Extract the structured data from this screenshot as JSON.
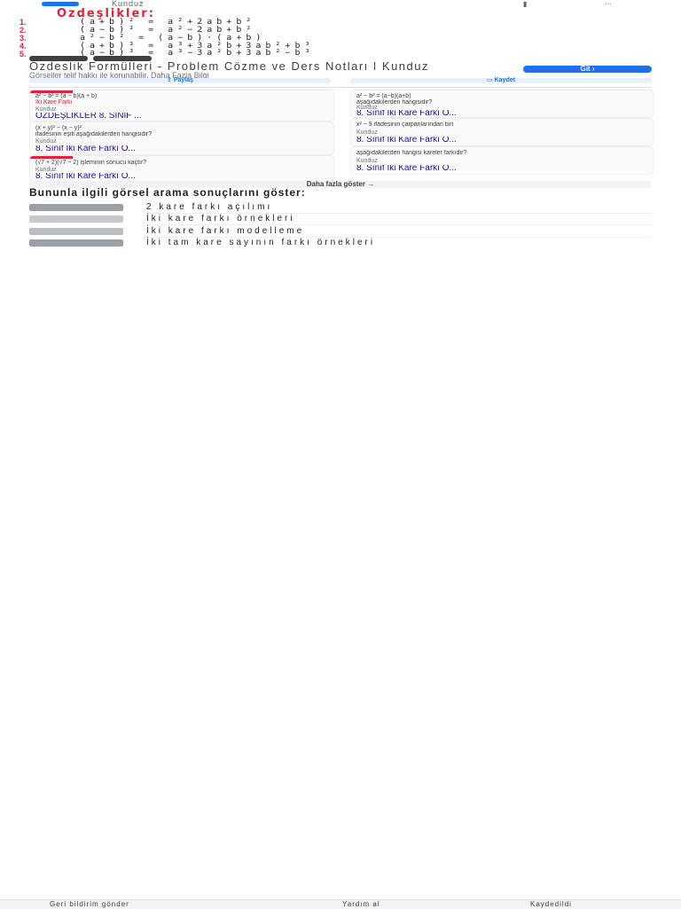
{
  "topbar": {
    "source": "Kunduz",
    "icon_left": "bookmark-icon",
    "icon_right": "more-icon"
  },
  "hero": {
    "title": "Özdeşlikler:",
    "items": [
      {
        "num": "1.",
        "formula": "(a+b)² = a²+2ab+b²"
      },
      {
        "num": "2.",
        "formula": "(a−b)² = a²−2ab+b²"
      },
      {
        "num": "3.",
        "formula": "a²−b² = (a−b)·(a+b)"
      },
      {
        "num": "4.",
        "formula": "(a+b)³ = a³+3a²b+3ab²+b³"
      },
      {
        "num": "5.",
        "formula": "(a−b)³ = a³−3a²b+3ab²−b³"
      }
    ]
  },
  "result": {
    "title": "Özdeşlik Formülleri - Problem Çözme ve Ders Notları | Kunduz",
    "subline": "Görseller telif hakkı ile korunabilir. Daha Fazla Bilgi",
    "visit_label": "Git",
    "share_label": "Paylaş",
    "save_label": "Kaydet"
  },
  "cards_left": [
    {
      "lines": [
        "a² − b² = (a − b)(a + b)",
        "İki Kare Farkı"
      ],
      "source": "Kunduz",
      "title": "ÖZDEŞLİKLER 8. SINIF ..."
    },
    {
      "lines": [
        "(x + y)² − (x − y)²",
        "ifadesinin eşiti aşağıdakilerden hangisidir?"
      ],
      "source": "Kunduz",
      "title": "8. Sınıf İki Kare Farkı Ö..."
    },
    {
      "lines": [
        "(√7 + 2)(√7 − 2) işleminin sonucu kaçtır?"
      ],
      "source": "Kunduz",
      "title": "8. Sınıf İki Kare Farkı Ö..."
    }
  ],
  "cards_right": [
    {
      "lines": [
        "a² − b² = (a−b)(a+b)",
        "aşağıdakilerden hangisidir?"
      ],
      "source": "Kunduz",
      "title": "8. Sınıf İki Kare Farkı Ö..."
    },
    {
      "lines": [
        "x² − 9 ifadesinin çarpanlarından biri"
      ],
      "source": "Kunduz",
      "title": "8. Sınıf İki Kare Farkı Ö..."
    },
    {
      "lines": [
        "aşağıdakilerden hangisi kareler farkıdır?"
      ],
      "source": "Kunduz",
      "title": "8. Sınıf İki Kare Farkı Ö..."
    }
  ],
  "more_label": "Daha fazla göster",
  "related": {
    "heading": "Bununla ilgili görsel arama sonuçlarını göster:",
    "items": [
      "2 kare farkı açılımı",
      "İki kare farkı örnekleri",
      "İki kare farkı modelleme",
      "İki tam kare sayının farkı örnekleri"
    ]
  },
  "footer": {
    "feedback": "Geri bildirim gönder",
    "help": "Yardım al",
    "saved": "Kaydedildi"
  }
}
